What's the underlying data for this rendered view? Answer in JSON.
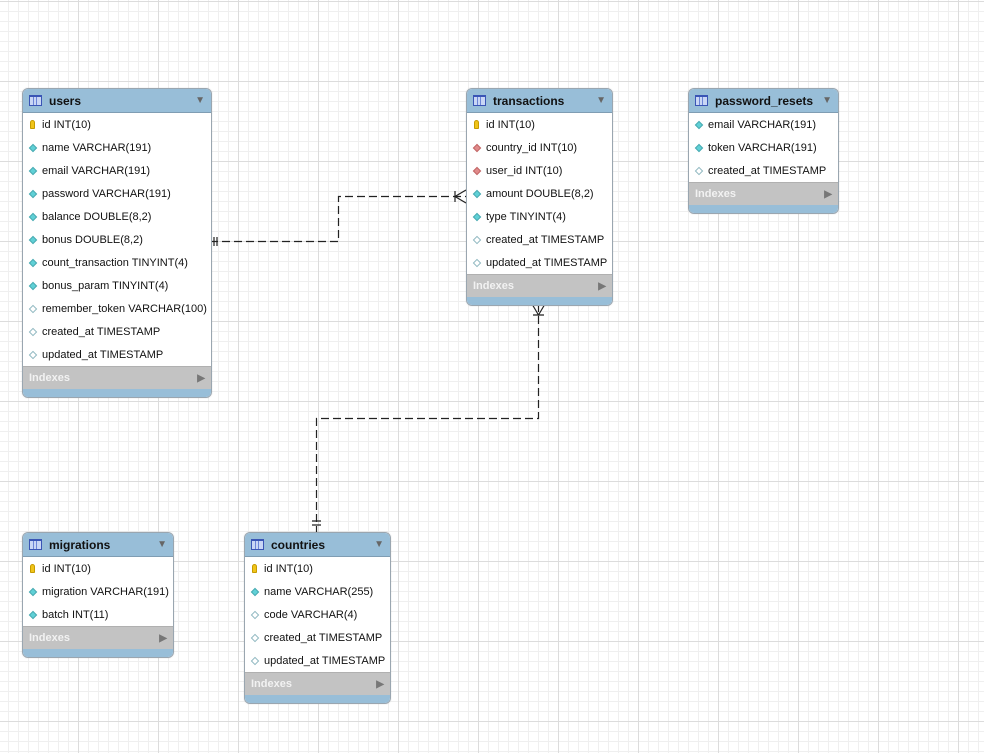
{
  "indexes_label": "Indexes",
  "tables": [
    {
      "name": "users",
      "columns": [
        {
          "text": "id INT(10)",
          "icon": "primary-key"
        },
        {
          "text": "name VARCHAR(191)",
          "icon": "not-null"
        },
        {
          "text": "email VARCHAR(191)",
          "icon": "not-null"
        },
        {
          "text": "password VARCHAR(191)",
          "icon": "not-null"
        },
        {
          "text": "balance DOUBLE(8,2)",
          "icon": "not-null"
        },
        {
          "text": "bonus DOUBLE(8,2)",
          "icon": "not-null"
        },
        {
          "text": "count_transaction TINYINT(4)",
          "icon": "not-null"
        },
        {
          "text": "bonus_param TINYINT(4)",
          "icon": "not-null"
        },
        {
          "text": "remember_token VARCHAR(100)",
          "icon": "nullable"
        },
        {
          "text": "created_at TIMESTAMP",
          "icon": "nullable"
        },
        {
          "text": "updated_at TIMESTAMP",
          "icon": "nullable"
        }
      ]
    },
    {
      "name": "transactions",
      "columns": [
        {
          "text": "id INT(10)",
          "icon": "primary-key"
        },
        {
          "text": "country_id INT(10)",
          "icon": "foreign-key"
        },
        {
          "text": "user_id INT(10)",
          "icon": "foreign-key"
        },
        {
          "text": "amount DOUBLE(8,2)",
          "icon": "not-null"
        },
        {
          "text": "type TINYINT(4)",
          "icon": "not-null"
        },
        {
          "text": "created_at TIMESTAMP",
          "icon": "nullable"
        },
        {
          "text": "updated_at TIMESTAMP",
          "icon": "nullable"
        }
      ]
    },
    {
      "name": "password_resets",
      "columns": [
        {
          "text": "email VARCHAR(191)",
          "icon": "not-null"
        },
        {
          "text": "token VARCHAR(191)",
          "icon": "not-null"
        },
        {
          "text": "created_at TIMESTAMP",
          "icon": "nullable"
        }
      ]
    },
    {
      "name": "migrations",
      "columns": [
        {
          "text": "id INT(10)",
          "icon": "primary-key"
        },
        {
          "text": "migration VARCHAR(191)",
          "icon": "not-null"
        },
        {
          "text": "batch INT(11)",
          "icon": "not-null"
        }
      ]
    },
    {
      "name": "countries",
      "columns": [
        {
          "text": "id INT(10)",
          "icon": "primary-key"
        },
        {
          "text": "name VARCHAR(255)",
          "icon": "not-null"
        },
        {
          "text": "code VARCHAR(4)",
          "icon": "nullable"
        },
        {
          "text": "created_at TIMESTAMP",
          "icon": "nullable"
        },
        {
          "text": "updated_at TIMESTAMP",
          "icon": "nullable"
        }
      ]
    }
  ],
  "relationships": [
    {
      "from": "users",
      "to": "transactions",
      "type": "one-to-many"
    },
    {
      "from": "countries",
      "to": "transactions",
      "type": "one-to-many"
    }
  ],
  "colors": {
    "header": "#98bed8",
    "indexes": "#c3c3c3",
    "foreign_key": "#e08a8a",
    "not_null": "#5fd0d6",
    "primary_key": "#f0c419"
  }
}
